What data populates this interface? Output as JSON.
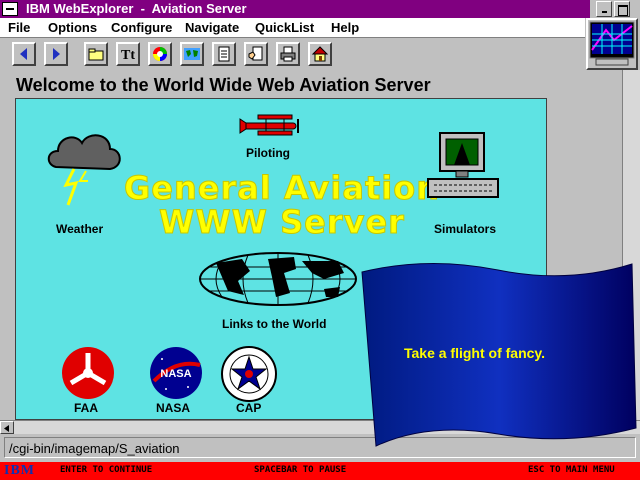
{
  "window": {
    "title": "IBM WebExplorer  -  Aviation Server"
  },
  "menu": {
    "items": [
      "File",
      "Options",
      "Configure",
      "Navigate",
      "QuickList",
      "Help"
    ]
  },
  "toolbar": {
    "buttons": [
      "back-icon",
      "forward-icon",
      "open-folder-icon",
      "font-icon",
      "color-wheel-icon",
      "globe-map-icon",
      "document-icon",
      "hand-document-icon",
      "printer-icon",
      "home-icon"
    ]
  },
  "page": {
    "heading": "Welcome to the World Wide Web Aviation Server"
  },
  "imagemap": {
    "title_line1": "General Aviation",
    "title_line2": "WWW Server",
    "labels": {
      "piloting": "Piloting",
      "weather": "Weather",
      "simulators": "Simulators",
      "links": "Links to the World",
      "faa": "FAA",
      "nasa": "NASA",
      "cap": "CAP"
    },
    "nasa_logo_text": "NASA",
    "background_color": "#5ee3e3",
    "title_color": "#ffff00"
  },
  "status": {
    "url": "/cgi-bin/imagemap/S_aviation"
  },
  "bottombar": {
    "logo": "IBM",
    "enter": "ENTER TO CONTINUE",
    "spacebar": "SPACEBAR TO PAUSE",
    "esc": "ESC TO MAIN MENU",
    "color": "#ff0000"
  },
  "overlay": {
    "text": "Take a flight of fancy.",
    "flag_color": "#000080"
  }
}
